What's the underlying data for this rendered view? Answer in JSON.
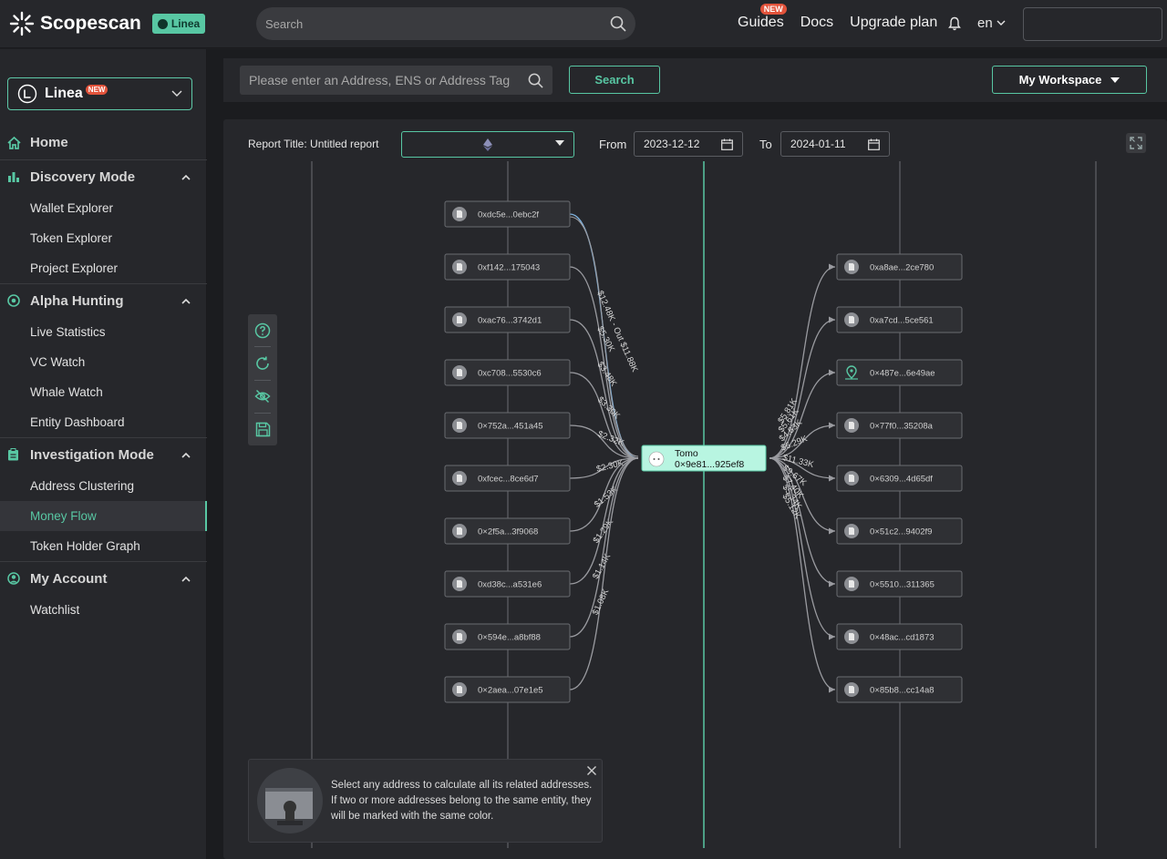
{
  "header": {
    "brand": "Scopescan",
    "chain_badge": "Linea",
    "search_placeholder": "Search",
    "nav": [
      {
        "label": "Guides",
        "badge": "NEW"
      },
      {
        "label": "Docs"
      },
      {
        "label": "Upgrade plan"
      }
    ],
    "language": "en"
  },
  "sidebar": {
    "chain_select": {
      "label": "Linea",
      "badge": "NEW"
    },
    "home": "Home",
    "sections": [
      {
        "title": "Discovery Mode",
        "items": [
          "Wallet Explorer",
          "Token Explorer",
          "Project Explorer"
        ]
      },
      {
        "title": "Alpha Hunting",
        "items": [
          "Live Statistics",
          "VC Watch",
          "Whale Watch",
          "Entity Dashboard"
        ]
      },
      {
        "title": "Investigation Mode",
        "items": [
          "Address Clustering",
          "Money Flow",
          "Token Holder Graph"
        ]
      },
      {
        "title": "My Account",
        "items": [
          "Watchlist"
        ]
      }
    ],
    "active_item": "Money Flow"
  },
  "toolbar": {
    "address_placeholder": "Please enter an Address, ENS or Address Tag",
    "search_label": "Search",
    "workspace_label": "My Workspace"
  },
  "report": {
    "title_label": "Report Title: Untitled report",
    "from_label": "From",
    "from_date": "2023-12-12",
    "to_label": "To",
    "to_date": "2024-01-11"
  },
  "graph": {
    "center": {
      "name": "Tomo",
      "address": "0×9e81...925ef8"
    },
    "inflows": [
      {
        "address": "0xdc5e...0ebc2f",
        "amount": "$12.48K - Out $11.88K"
      },
      {
        "address": "0xf142...175043",
        "amount": "$5.30K"
      },
      {
        "address": "0xac76...3742d1",
        "amount": "$3.48K"
      },
      {
        "address": "0xc708...5530c6",
        "amount": "$3.30K"
      },
      {
        "address": "0×752a...451a45",
        "amount": "$2.32K"
      },
      {
        "address": "0xfcec...8ce6d7",
        "amount": "$2.30K"
      },
      {
        "address": "0×2f5a...3f9068",
        "amount": "$1.53K"
      },
      {
        "address": "0xd38c...a531e6",
        "amount": "$1.29K"
      },
      {
        "address": "0×594e...a8bf88",
        "amount": "$1.14K"
      },
      {
        "address": "0×2aea...07e1e5",
        "amount": "$1.08K"
      }
    ],
    "outflows": [
      {
        "address": "0xa8ae...2ce780",
        "amount": "$5.81K"
      },
      {
        "address": "0xa7cd...5ce561",
        "amount": "$5.61K"
      },
      {
        "address": "0×487e...6e49ae",
        "amount": "$4.83K",
        "icon": "location-pin-icon"
      },
      {
        "address": "0×77f0...35208a",
        "amount": "$6.29K"
      },
      {
        "address": "0×6309...4d65df",
        "amount": "$11.33K"
      },
      {
        "address": "0×51c2...9402f9",
        "amount": "$9.67K"
      },
      {
        "address": "0×5510...311365",
        "amount": "$7.40K"
      },
      {
        "address": "0×48ac...cd1873",
        "amount": "$5.34K"
      },
      {
        "address": "0×85b8...cc14a8",
        "amount": "$5.12K"
      }
    ]
  },
  "tip": {
    "text": "Select any address to calculate all its related addresses. If two or more addresses belong to the same entity, they will be marked with the same color."
  },
  "colors": {
    "accent": "#58c7a3",
    "panel": "#26272b",
    "node_bg": "#2f3034",
    "edge": "#9a9ba0",
    "edge_highlight": "#7fb3e0"
  }
}
